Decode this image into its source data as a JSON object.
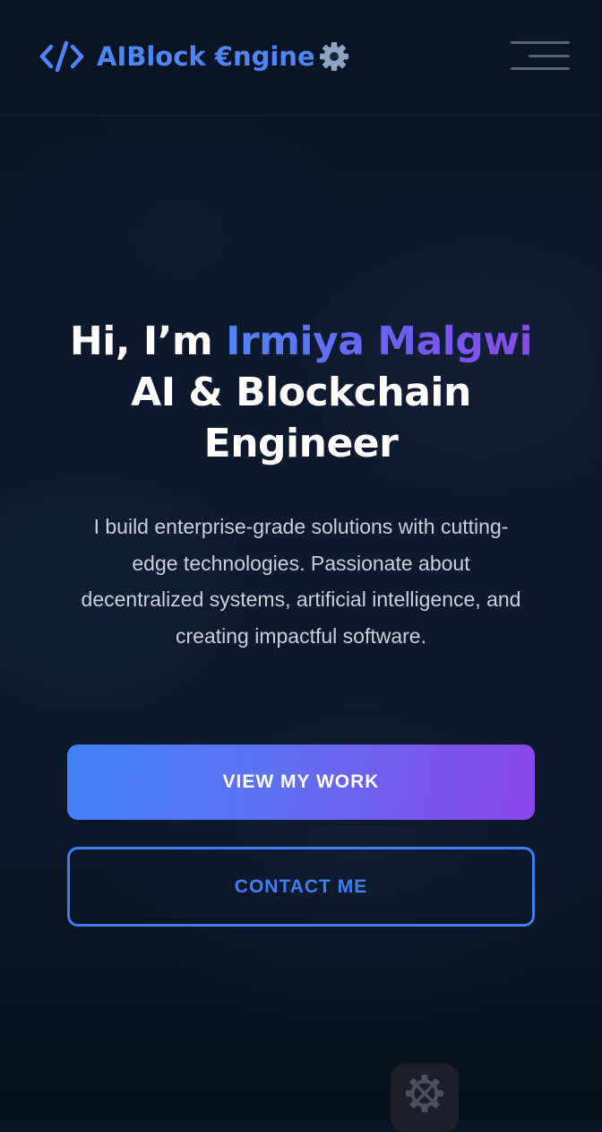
{
  "header": {
    "logo_text": "AIBlock €ngine",
    "logo_icon": "code-brackets-icon",
    "gear_icon": "gear-icon",
    "menu_icon": "hamburger-menu-icon"
  },
  "hero": {
    "greeting": "Hi, I’m ",
    "name": "Irmiya Malgwi",
    "role_line1": "AI & Blockchain",
    "role_line2": "Engineer",
    "description": "I build enterprise-grade solutions with cutting-edge technologies. Passionate about decentralized systems, artificial intelligence, and creating impactful software."
  },
  "actions": {
    "primary_label": "VIEW MY WORK",
    "secondary_label": "CONTACT ME"
  },
  "floating_button": {
    "icon": "settings-tools-icon"
  },
  "colors": {
    "accent_blue": "#4f86f7",
    "accent_purple": "#8a44e9",
    "background": "#0b1424"
  }
}
